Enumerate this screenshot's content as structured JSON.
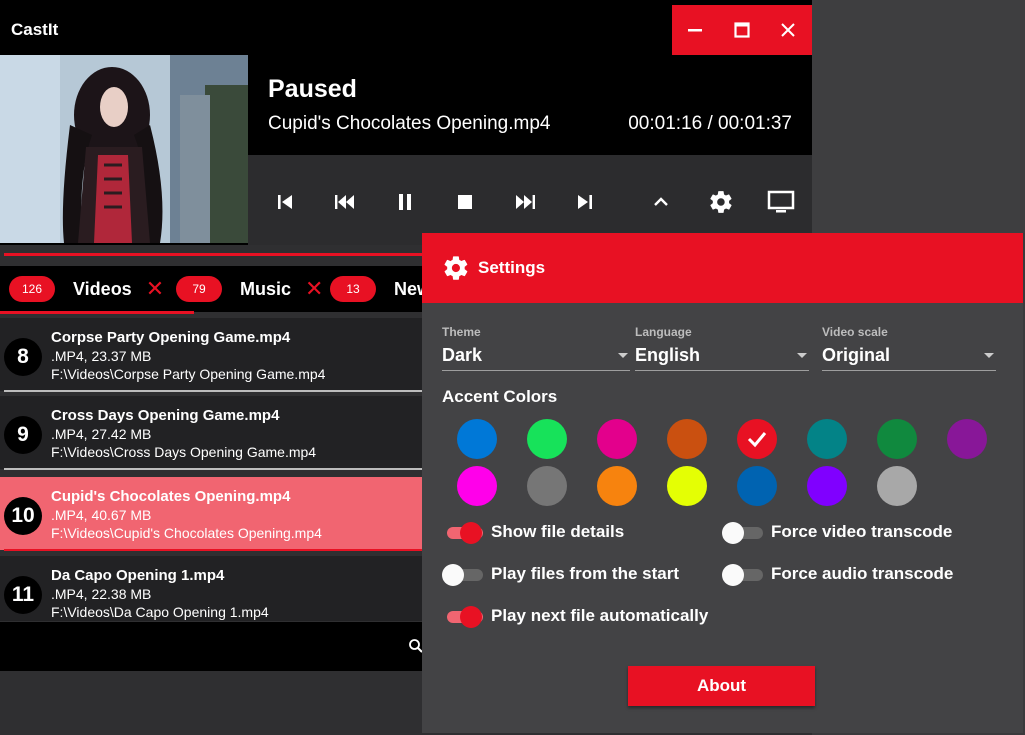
{
  "app": {
    "title": "CastIt"
  },
  "player": {
    "status": "Paused",
    "filename": "Cupid's Chocolates Opening.mp4",
    "elapsed": "00:01:16",
    "separator": "/",
    "total": "00:01:37"
  },
  "tabs": [
    {
      "count": "126",
      "label": "Videos"
    },
    {
      "count": "79",
      "label": "Music"
    },
    {
      "count": "13",
      "label": "New"
    }
  ],
  "files": [
    {
      "position": "8",
      "title": "Corpse Party Opening Game.mp4",
      "info": ".MP4, 23.37 MB",
      "path": "F:\\Videos\\Corpse Party Opening Game.mp4"
    },
    {
      "position": "9",
      "title": "Cross Days Opening Game.mp4",
      "info": ".MP4, 27.42 MB",
      "path": "F:\\Videos\\Cross Days Opening Game.mp4"
    },
    {
      "position": "10",
      "title": "Cupid's Chocolates Opening.mp4",
      "info": ".MP4, 40.67 MB",
      "path": "F:\\Videos\\Cupid's Chocolates Opening.mp4"
    },
    {
      "position": "11",
      "title": "Da Capo Opening 1.mp4",
      "info": ".MP4, 22.38 MB",
      "path": "F:\\Videos\\Da Capo Opening 1.mp4"
    }
  ],
  "settings": {
    "title": "Settings",
    "theme": {
      "label": "Theme",
      "value": "Dark"
    },
    "language": {
      "label": "Language",
      "value": "English"
    },
    "video_scale": {
      "label": "Video scale",
      "value": "Original"
    },
    "accent_title": "Accent Colors",
    "accent_colors": [
      "#0078d7",
      "#17e25a",
      "#e3008c",
      "#ca5010",
      "#e81123",
      "#038387",
      "#10893e",
      "#881798",
      "#ff00ea",
      "#767676",
      "#f7830e",
      "#e4ff04",
      "#0063b1",
      "#8000ff",
      "#a8a8a8"
    ],
    "selected_accent": "#e81123",
    "toggles": {
      "show_file_details": {
        "label": "Show file details",
        "on": true
      },
      "force_video_transcode": {
        "label": "Force video transcode",
        "on": false
      },
      "play_from_start": {
        "label": "Play files from the start",
        "on": false
      },
      "force_audio_transcode": {
        "label": "Force audio transcode",
        "on": false
      },
      "play_next": {
        "label": "Play next file automatically",
        "on": true
      }
    },
    "about_label": "About"
  },
  "colors": {
    "accent": "#e81123",
    "selected_row": "#f16571"
  }
}
